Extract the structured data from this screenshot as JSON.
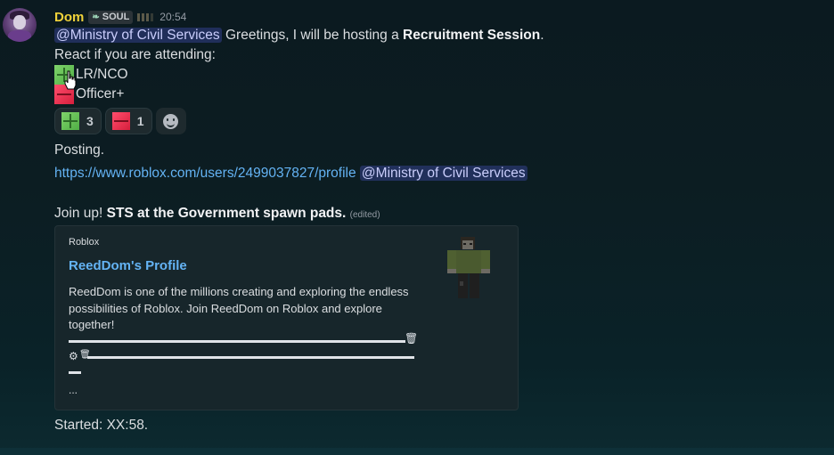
{
  "author": {
    "name": "Dom",
    "tag": "SOUL",
    "timestamp": "20:54"
  },
  "message": {
    "mention": "@Ministry of Civil Services",
    "greeting_prefix": " Greetings, I will be hosting a ",
    "greeting_bold": "Recruitment Session",
    "greeting_suffix": ".",
    "react_prompt": "React if you are attending:",
    "option_1": "LR/NCO",
    "option_2": "Officer+",
    "posting": "Posting.",
    "profile_url": "https://www.roblox.com/users/2499037827/profile",
    "join_prefix": "Join up! ",
    "join_bold": "STS at the Government spawn pads.",
    "edited": "(edited)",
    "started": "Started: XX:58."
  },
  "reactions": [
    {
      "emoji": "plus",
      "count": "3"
    },
    {
      "emoji": "minus",
      "count": "1"
    }
  ],
  "embed": {
    "provider": "Roblox",
    "title": "ReedDom's Profile",
    "description": "ReedDom is one of the millions creating and exploring the endless possibilities of Roblox. Join ReedDom on Roblox and explore together!",
    "ellipsis": "..."
  },
  "colors": {
    "username": "#f0d23a",
    "link": "#64b3f4",
    "mention_bg": "#3a4b8a",
    "plus_green": "#4fae45",
    "minus_red": "#d61f3c"
  }
}
